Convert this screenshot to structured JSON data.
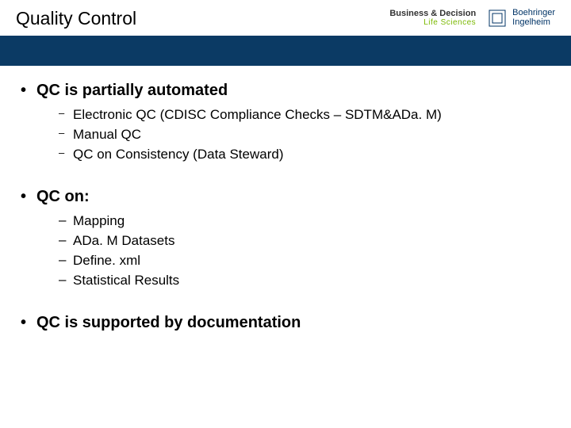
{
  "title": "Quality Control",
  "logos": {
    "bd_top": "Business & Decision",
    "bd_bottom": "Life Sciences",
    "bi_line1": "Boehringer",
    "bi_line2": "Ingelheim"
  },
  "bullets": {
    "b1": {
      "text": "QC is partially automated",
      "subs": [
        "Electronic QC (CDISC Compliance Checks – SDTM&ADa. M)",
        "Manual QC",
        "QC on Consistency (Data Steward)"
      ]
    },
    "b2": {
      "text": "QC on:",
      "subs": [
        "Mapping",
        "ADa. M Datasets",
        "Define. xml",
        "Statistical Results"
      ]
    },
    "b3": {
      "text": "QC is supported by documentation"
    }
  }
}
